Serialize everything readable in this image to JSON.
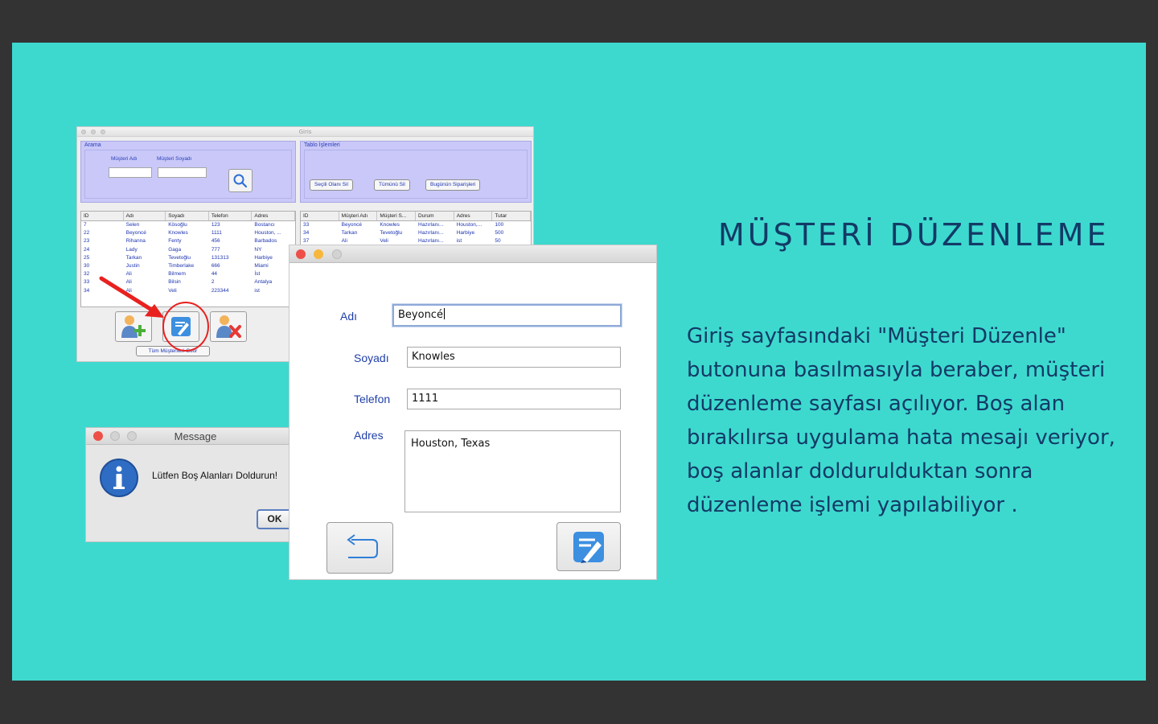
{
  "slide": {
    "heading": "MÜŞTERİ DÜZENLEME",
    "body": "Giriş sayfasındaki \"Müşteri Düzenle\" butonuna basılmasıyla beraber, müşteri düzenleme sayfası açılıyor. Boş alan bırakılırsa uygulama hata mesajı veriyor, boş alanlar doldurulduktan sonra düzenleme işlemi yapılabiliyor ."
  },
  "giris_window": {
    "title": "Giris",
    "search_panel": {
      "title": "Arama",
      "first_name_label": "Müşteri Adı",
      "last_name_label": "Müşteri Soyadı",
      "search_icon": "search-icon"
    },
    "table_ops_panel": {
      "title": "Tablo İşlemleri",
      "buttons": [
        "Seçili Olanı Sil",
        "Tümünü Sil",
        "Bugünün Siparişleri"
      ]
    },
    "customers_table": {
      "columns": [
        "ID",
        "Adı",
        "Soyadı",
        "Telefon",
        "Adres"
      ],
      "rows": [
        [
          "7",
          "Selen",
          "Kösoğlu",
          "123",
          "Bostancı"
        ],
        [
          "22",
          "Beyoncé",
          "Knowles",
          "1111",
          "Houston, ..."
        ],
        [
          "23",
          "Rihanna",
          "Fenty",
          "456",
          "Barbados"
        ],
        [
          "24",
          "Lady",
          "Gaga",
          "777",
          "NY"
        ],
        [
          "25",
          "Tarkan",
          "Tevetoğlu",
          "131313",
          "Harbiye"
        ],
        [
          "30",
          "Justin",
          "Timberlake",
          "666",
          "Miami"
        ],
        [
          "32",
          "Ali",
          "Bilmem",
          "44",
          "İst"
        ],
        [
          "33",
          "Ali",
          "Bilsin",
          "2",
          "Antalya"
        ],
        [
          "34",
          "Ali",
          "Veli",
          "223344",
          "ist"
        ]
      ]
    },
    "orders_table": {
      "columns": [
        "ID",
        "Müşteri Adı",
        "Müşteri S...",
        "Durum",
        "Adres",
        "Tutar"
      ],
      "rows": [
        [
          "33",
          "Beyoncé",
          "Knowles",
          "Hazırlanı...",
          "Houston,...",
          "100"
        ],
        [
          "34",
          "Tarkan",
          "Tevetoğlu",
          "Hazırlanı...",
          "Harbiye",
          "500"
        ],
        [
          "37",
          "Ali",
          "Veli",
          "Hazırlanı...",
          "ist",
          "50"
        ]
      ]
    },
    "action_icons": [
      "add-user-icon",
      "edit-icon",
      "delete-user-icon"
    ],
    "all_customers_button": "Tüm Müşterileri Getir"
  },
  "edit_window": {
    "name_label": "Adı",
    "name_value": "Beyoncé",
    "surname_label": "Soyadı",
    "surname_value": "Knowles",
    "phone_label": "Telefon",
    "phone_value": "1111",
    "address_label": "Adres",
    "address_value": "Houston, Texas",
    "back_icon": "back-arrow-icon",
    "save_icon": "edit-icon"
  },
  "message_dialog": {
    "title": "Message",
    "text": "Lütfen Boş Alanları Doldurun!",
    "ok_label": "OK",
    "info_icon": "info-icon"
  },
  "colors": {
    "slide_bg": "#3dd9cf",
    "outer_bg": "#333333",
    "heading": "#133a66",
    "label_blue": "#1f3fa8",
    "panel": "#c9c8f8",
    "annotation_red": "#e8211f"
  }
}
